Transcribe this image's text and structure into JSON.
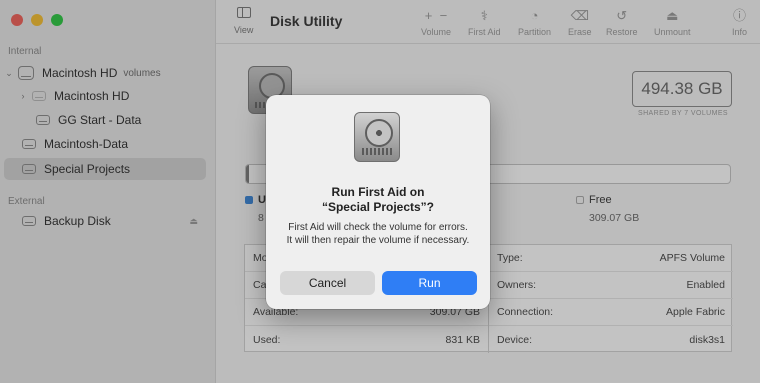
{
  "toolbar": {
    "view_label": "View",
    "title": "Disk Utility",
    "volume_label": "Volume",
    "first_aid_label": "First Aid",
    "partition_label": "Partition",
    "erase_label": "Erase",
    "restore_label": "Restore",
    "unmount_label": "Unmount",
    "info_label": "Info"
  },
  "sidebar": {
    "internal_label": "Internal",
    "external_label": "External",
    "items": [
      {
        "label": "Macintosh HD",
        "sub": "volumes"
      },
      {
        "label": "Macintosh HD"
      },
      {
        "label": "GG Start - Data"
      },
      {
        "label": "Macintosh-Data"
      },
      {
        "label": "Special Projects"
      },
      {
        "label": "Backup Disk"
      }
    ]
  },
  "main": {
    "capacity": "494.38 GB",
    "capacity_sub": "SHARED BY 7 VOLUMES",
    "used_label": "U",
    "used_value": "8",
    "free_label": "Free",
    "free_value": "309.07 GB",
    "info_left": [
      {
        "key": "Mo",
        "value": ""
      },
      {
        "key": "Ca",
        "value": ""
      },
      {
        "key": "Available:",
        "value": "309.07 GB"
      },
      {
        "key": "Used:",
        "value": "831 KB"
      }
    ],
    "info_right": [
      {
        "key": "Type:",
        "value": "APFS Volume"
      },
      {
        "key": "Owners:",
        "value": "Enabled"
      },
      {
        "key": "Connection:",
        "value": "Apple Fabric"
      },
      {
        "key": "Device:",
        "value": "disk3s1"
      }
    ]
  },
  "dialog": {
    "title_line1": "Run First Aid on",
    "title_line2": "“Special Projects”?",
    "body": "First Aid will check the volume for errors. It will then repair the volume if necessary.",
    "cancel_label": "Cancel",
    "run_label": "Run"
  }
}
